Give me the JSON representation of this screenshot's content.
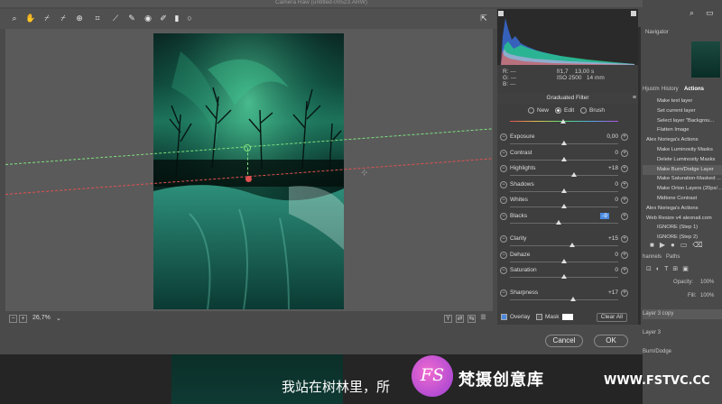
{
  "window": {
    "title": "Camera Raw (untitled-00523.ARW)"
  },
  "toolbar": {
    "tools": [
      "zoom-tool",
      "hand-tool",
      "white-balance-tool",
      "color-sampler-tool",
      "targeted-adjustment-tool",
      "crop-tool",
      "straighten-tool",
      "spot-removal-tool",
      "red-eye-tool",
      "adjustment-brush-tool",
      "graduated-filter-tool",
      "radial-filter-tool",
      "preferences",
      "rotate"
    ]
  },
  "status": {
    "zoom": "26,7%"
  },
  "camera_info": {
    "r_label": "R:",
    "r_value": "---",
    "g_label": "G:",
    "g_value": "---",
    "b_label": "B:",
    "b_value": "---",
    "aperture": "f/1,7",
    "shutter": "13,00 s",
    "iso": "ISO 2500",
    "focal": "14 mm"
  },
  "panel": {
    "title": "Graduated Filter",
    "modes": {
      "new": "New",
      "edit": "Edit",
      "brush": "Brush",
      "selected": "Edit"
    },
    "sliders": [
      {
        "label": "Exposure",
        "value": "0,00",
        "level": 0.5
      },
      {
        "label": "Contrast",
        "value": "0",
        "level": 0.5
      },
      {
        "label": "Highlights",
        "value": "+18",
        "level": 0.59
      },
      {
        "label": "Shadows",
        "value": "0",
        "level": 0.5
      },
      {
        "label": "Whites",
        "value": "0",
        "level": 0.5
      },
      {
        "label": "Blacks",
        "value": "-9",
        "level": 0.45,
        "selected": true
      },
      {
        "label": "Clarity",
        "value": "+15",
        "level": 0.575
      },
      {
        "label": "Dehaze",
        "value": "0",
        "level": 0.5
      },
      {
        "label": "Saturation",
        "value": "0",
        "level": 0.5
      },
      {
        "label": "Sharpness",
        "value": "+17",
        "level": 0.585
      }
    ],
    "overlay_label": "Overlay",
    "mask_label": "Mask",
    "clear_all": "Clear All"
  },
  "buttons": {
    "cancel": "Cancel",
    "ok": "OK"
  },
  "ps_panels": {
    "navigator": "Navigator",
    "tabs": [
      "Hjustm",
      "History",
      "Actions"
    ],
    "actions": [
      "Make text layer",
      "Set current layer",
      "Select layer \"Backgrou...",
      "Flatten Image",
      "Alex Noriega's Actions",
      "Make Luminosity Masks",
      "Delete Luminosity Masks",
      "Make Burn/Dodge Layer",
      "Make Saturation-Masked ...",
      "Make Orton Layers (20px/...",
      "Midtone Contrast",
      "Alex Noriega's Actions",
      "Web Resize v4 alexnail.com",
      "IGNORE (Step 1)",
      "IGNORE (Step 2)"
    ],
    "layers_tabs": [
      "hannels",
      "Paths"
    ],
    "opacity_label": "Opacity:",
    "opacity_value": "100%",
    "fill_label": "Fill:",
    "fill_value": "100%",
    "layers": [
      "Layer 3 copy",
      "Layer 3",
      "Burn/Dodge"
    ]
  },
  "subtitle": "我站在树林里，所",
  "watermark": {
    "badge": "FS",
    "name": "梵摄创意库",
    "url": "WWW.FSTVC.CC"
  },
  "colors": {
    "accent_blue": "#4b8ae0",
    "green_guide": "#7fe07f",
    "red_guide": "#e05252",
    "aurora": "#1f7b60"
  }
}
